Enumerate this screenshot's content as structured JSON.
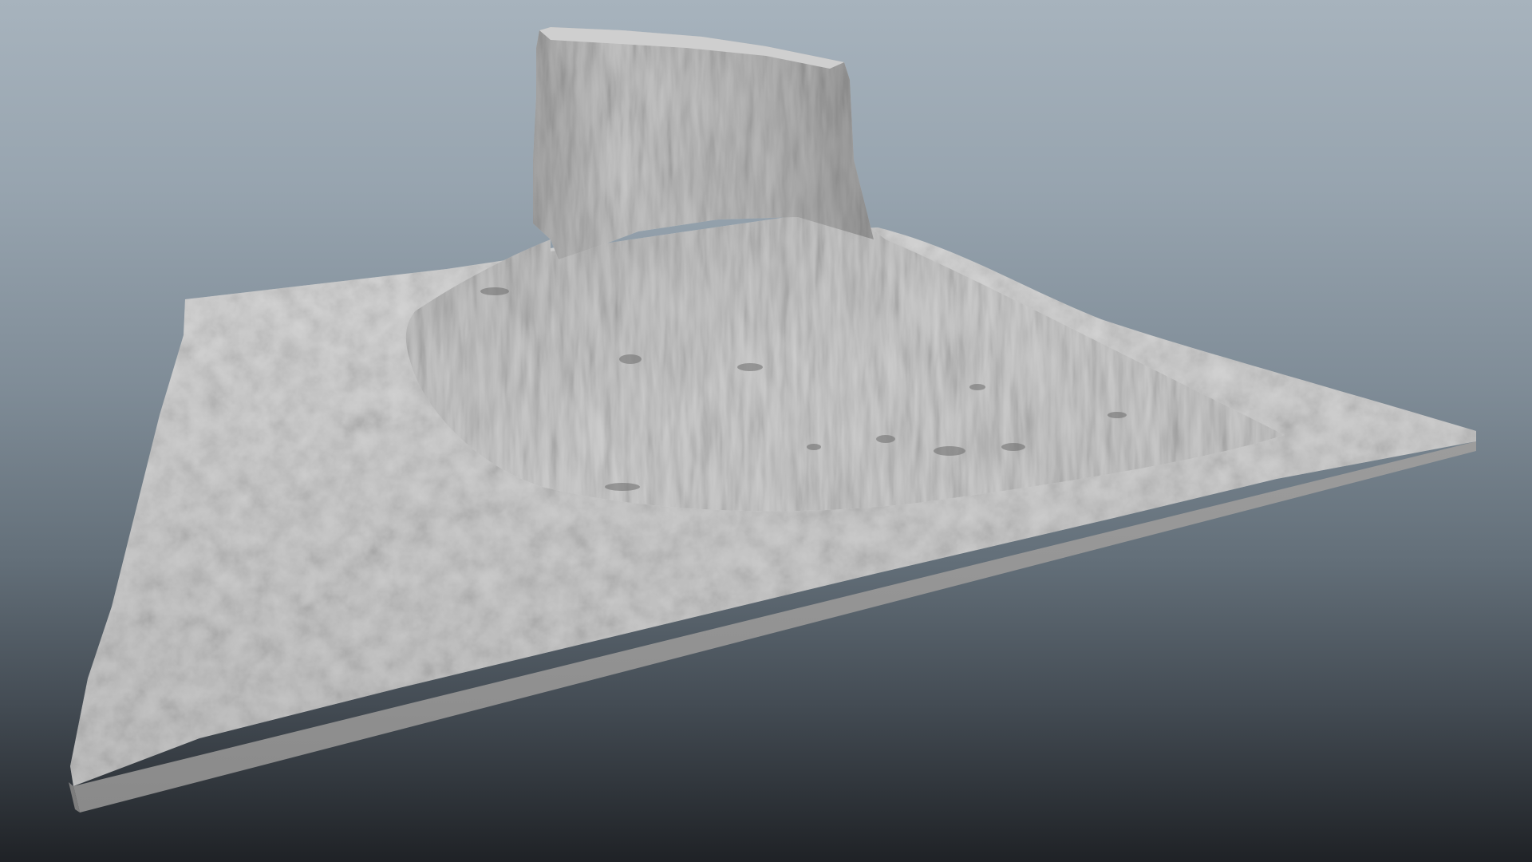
{
  "viewport": {
    "background_top": "#a7b3bd",
    "background_bottom": "#1f2226",
    "model_color": "#c9c9c9"
  }
}
